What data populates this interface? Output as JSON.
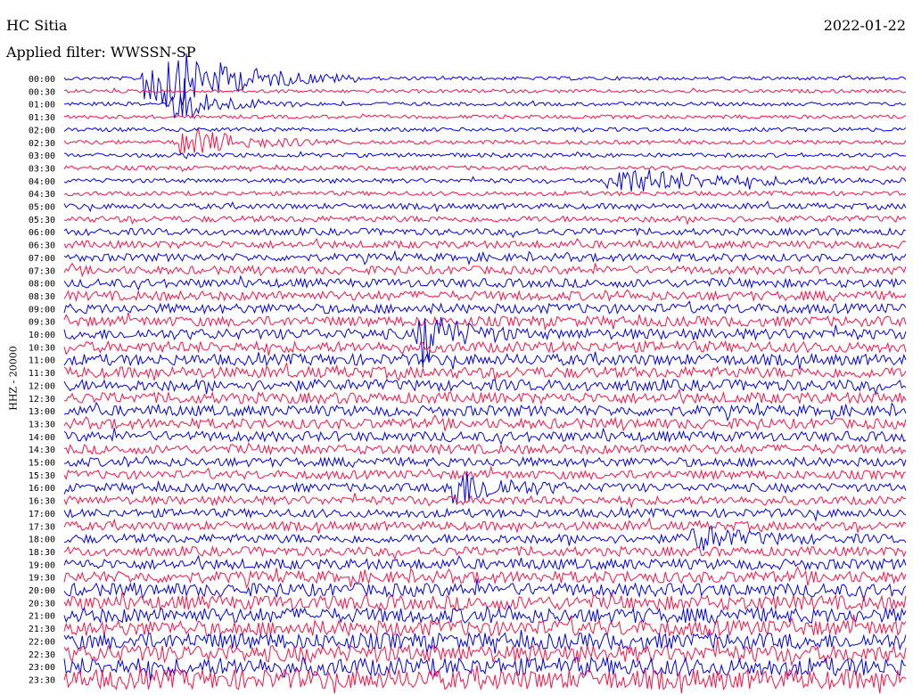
{
  "header": {
    "station": "HC Sitia",
    "date": "2022-01-22",
    "filter": "Applied filter: WWSSN-SP"
  },
  "chart_data": {
    "type": "line",
    "title": "",
    "ylabel": "HHZ - 20000",
    "row_labels": [
      "00:00",
      "00:30",
      "01:00",
      "01:30",
      "02:00",
      "02:30",
      "03:00",
      "03:30",
      "04:00",
      "04:30",
      "05:00",
      "05:30",
      "06:00",
      "06:30",
      "07:00",
      "07:30",
      "08:00",
      "08:30",
      "09:00",
      "09:30",
      "10:00",
      "10:30",
      "11:00",
      "11:30",
      "12:00",
      "12:30",
      "13:00",
      "13:30",
      "14:00",
      "14:30",
      "15:00",
      "15:30",
      "16:00",
      "16:30",
      "17:00",
      "17:30",
      "18:00",
      "18:30",
      "19:00",
      "19:30",
      "20:00",
      "20:30",
      "21:00",
      "21:30",
      "22:00",
      "22:30",
      "23:00",
      "23:30"
    ],
    "colors": {
      "even_rows": "#0000ee",
      "odd_rows": "#ff1144"
    },
    "noise_level_by_row": [
      0.28,
      0.28,
      0.3,
      0.3,
      0.32,
      0.32,
      0.34,
      0.34,
      0.35,
      0.35,
      0.45,
      0.5,
      0.55,
      0.6,
      0.62,
      0.65,
      0.7,
      0.75,
      0.78,
      0.8,
      0.85,
      0.88,
      0.9,
      0.9,
      0.9,
      0.88,
      0.85,
      0.82,
      0.8,
      0.75,
      0.72,
      0.7,
      0.68,
      0.68,
      0.68,
      0.7,
      0.72,
      0.75,
      0.85,
      0.95,
      1.05,
      1.15,
      1.2,
      1.25,
      1.3,
      1.35,
      1.45,
      1.6
    ],
    "events": [
      {
        "row": 0,
        "time_min": 3.0,
        "amplitude": 6.5,
        "duration_min": 2.5
      },
      {
        "row": 2,
        "time_min": 4.0,
        "amplitude": 3.0,
        "duration_min": 1.5
      },
      {
        "row": 5,
        "time_min": 4.2,
        "amplitude": 2.5,
        "duration_min": 2.0
      },
      {
        "row": 8,
        "time_min": 19.5,
        "amplitude": 2.2,
        "duration_min": 3.5
      },
      {
        "row": 20,
        "time_min": 12.8,
        "amplitude": 4.0,
        "duration_min": 1.2
      },
      {
        "row": 32,
        "time_min": 13.8,
        "amplitude": 3.5,
        "duration_min": 1.5
      },
      {
        "row": 36,
        "time_min": 22.5,
        "amplitude": 2.0,
        "duration_min": 1.5
      }
    ]
  }
}
